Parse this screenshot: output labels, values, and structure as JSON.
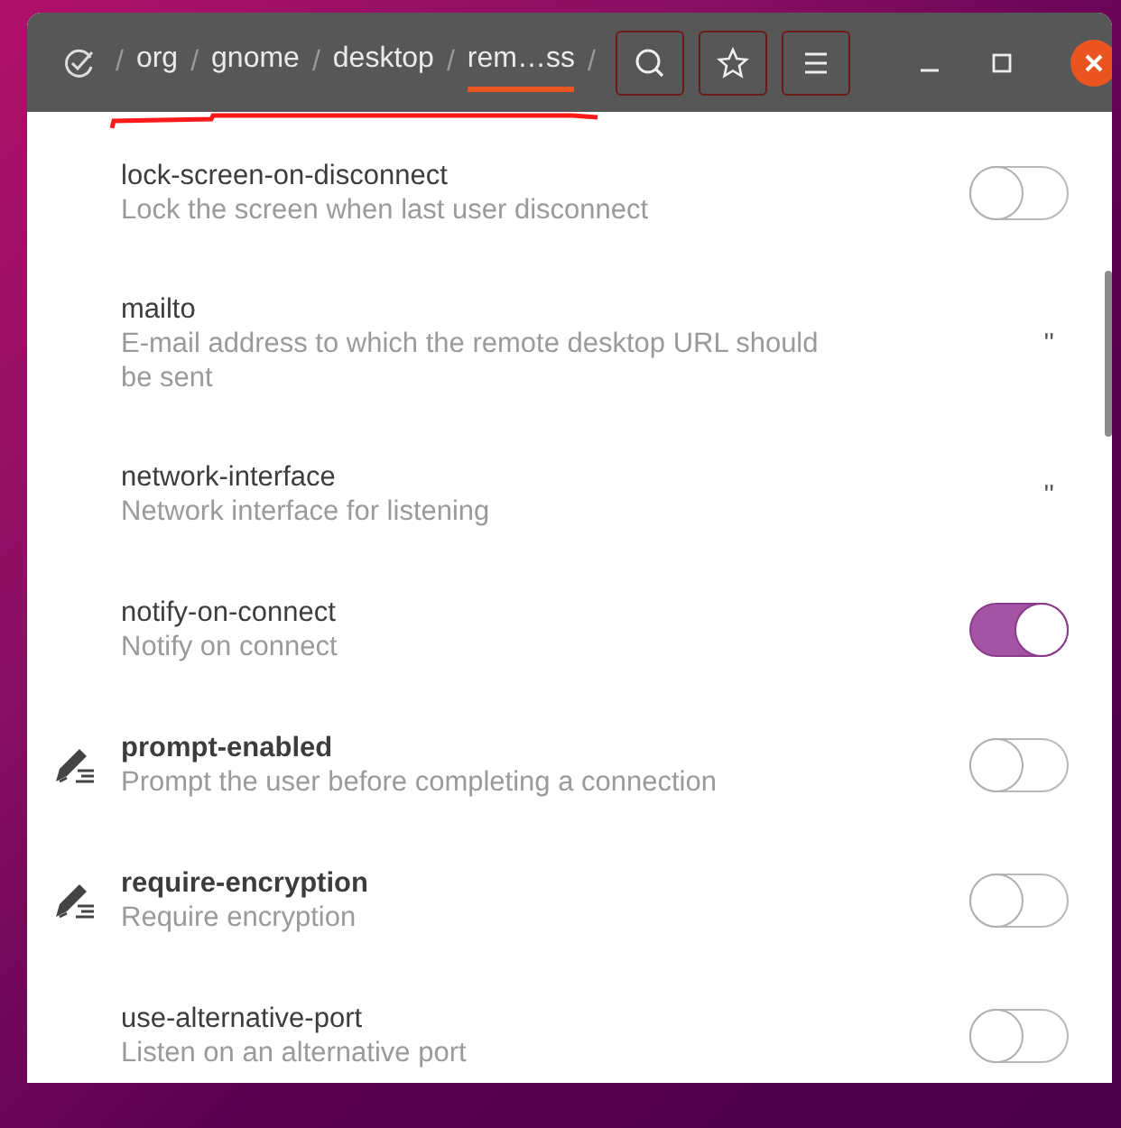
{
  "breadcrumb": {
    "items": [
      {
        "separator": "/",
        "label": "org",
        "selected": false
      },
      {
        "separator": "/",
        "label": "gnome",
        "selected": false
      },
      {
        "separator": "/",
        "label": "desktop",
        "selected": false
      },
      {
        "separator": "/",
        "label": "rem…ss",
        "selected": true
      }
    ],
    "trailing_separator": "/"
  },
  "keys": [
    {
      "name": "lock-screen-on-disconnect",
      "description": "Lock the screen when last user disconnect",
      "modified": false,
      "kind": "toggle",
      "on": false
    },
    {
      "name": "mailto",
      "description": "E-mail address to which the remote desktop URL should be sent",
      "modified": false,
      "kind": "text",
      "value": "''"
    },
    {
      "name": "network-interface",
      "description": "Network interface for listening",
      "modified": false,
      "kind": "text",
      "value": "''"
    },
    {
      "name": "notify-on-connect",
      "description": "Notify on connect",
      "modified": false,
      "kind": "toggle",
      "on": true
    },
    {
      "name": "prompt-enabled",
      "description": "Prompt the user before completing a connection",
      "modified": true,
      "kind": "toggle",
      "on": false
    },
    {
      "name": "require-encryption",
      "description": "Require encryption",
      "modified": true,
      "kind": "toggle",
      "on": false
    },
    {
      "name": "use-alternative-port",
      "description": "Listen on an alternative port",
      "modified": false,
      "kind": "toggle",
      "on": false
    }
  ]
}
